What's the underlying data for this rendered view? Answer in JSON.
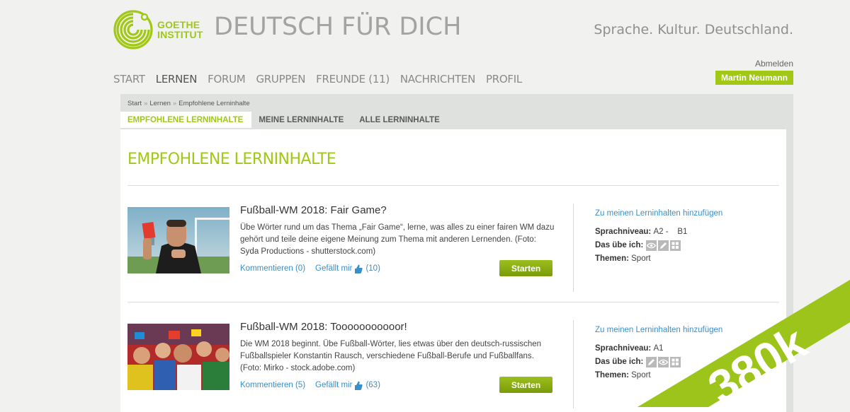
{
  "brand": {
    "logo_line1": "GOETHE",
    "logo_line2": "INSTITUT",
    "accent": "#a0c814"
  },
  "header": {
    "site_title": "DEUTSCH FÜR DICH",
    "tagline": "Sprache. Kultur. Deutschland.",
    "logout": "Abmelden",
    "user_name": "Martin Neumann"
  },
  "nav": [
    "START",
    "LERNEN",
    "FORUM",
    "GRUPPEN",
    "FREUNDE (11)",
    "NACHRICHTEN",
    "PROFIL"
  ],
  "nav_active": "LERNEN",
  "breadcrumb": [
    "Start",
    "Lernen",
    "Empfohlene Lerninhalte"
  ],
  "breadcrumb_separator": "»",
  "tabs": [
    "EMPFOHLENE LERNINHALTE",
    "MEINE LERNINHALTE",
    "ALLE LERNINHALTE"
  ],
  "tab_active": "EMPFOHLENE LERNINHALTE",
  "page_heading": "EMPFOHLENE LERNINHALTE",
  "items": [
    {
      "title": "Fußball-WM 2018: Fair Game?",
      "description": "Übe Wörter rund um das Thema „Fair Game“, lerne, was alles zu einer fairen WM dazu gehört und teile deine eigene Meinung zum Thema mit anderen Lernenden. (Foto: Syda Productions - shutterstock.com)",
      "comments": "Kommentieren (0)",
      "likes_label": "Gefällt mir",
      "likes_count": "(10)",
      "button": "Starten",
      "add_link": "Zu meinen Lerninhalten hinzufügen",
      "level_label": "Sprachniveau:",
      "level_value": "A2 -    B1",
      "practice_label": "Das übe ich:",
      "practice_icons": [
        "eye-icon",
        "pencil-icon",
        "puzzle-icon"
      ],
      "themes_label": "Themen:",
      "themes_value": "Sport"
    },
    {
      "title": "Fußball-WM 2018: Tooooooooooor!",
      "description": "Die WM 2018 beginnt. Übe Fußball-Wörter, lies etwas über den deutsch-russischen Fußballspieler Konstantin Rausch, verschiedene Fußball-Berufe und Fußballfans. (Foto: Mirko - stock.adobe.com)",
      "comments": "Kommentieren (5)",
      "likes_label": "Gefällt mir",
      "likes_count": "(63)",
      "button": "Starten",
      "add_link": "Zu meinen Lerninhalten hinzufügen",
      "level_label": "Sprachniveau:",
      "level_value": "A1",
      "practice_label": "Das übe ich:",
      "practice_icons": [
        "pencil-icon",
        "eye-icon",
        "puzzle-icon"
      ],
      "themes_label": "Themen:",
      "themes_value": "Sport"
    }
  ],
  "corner_badge": "380k"
}
